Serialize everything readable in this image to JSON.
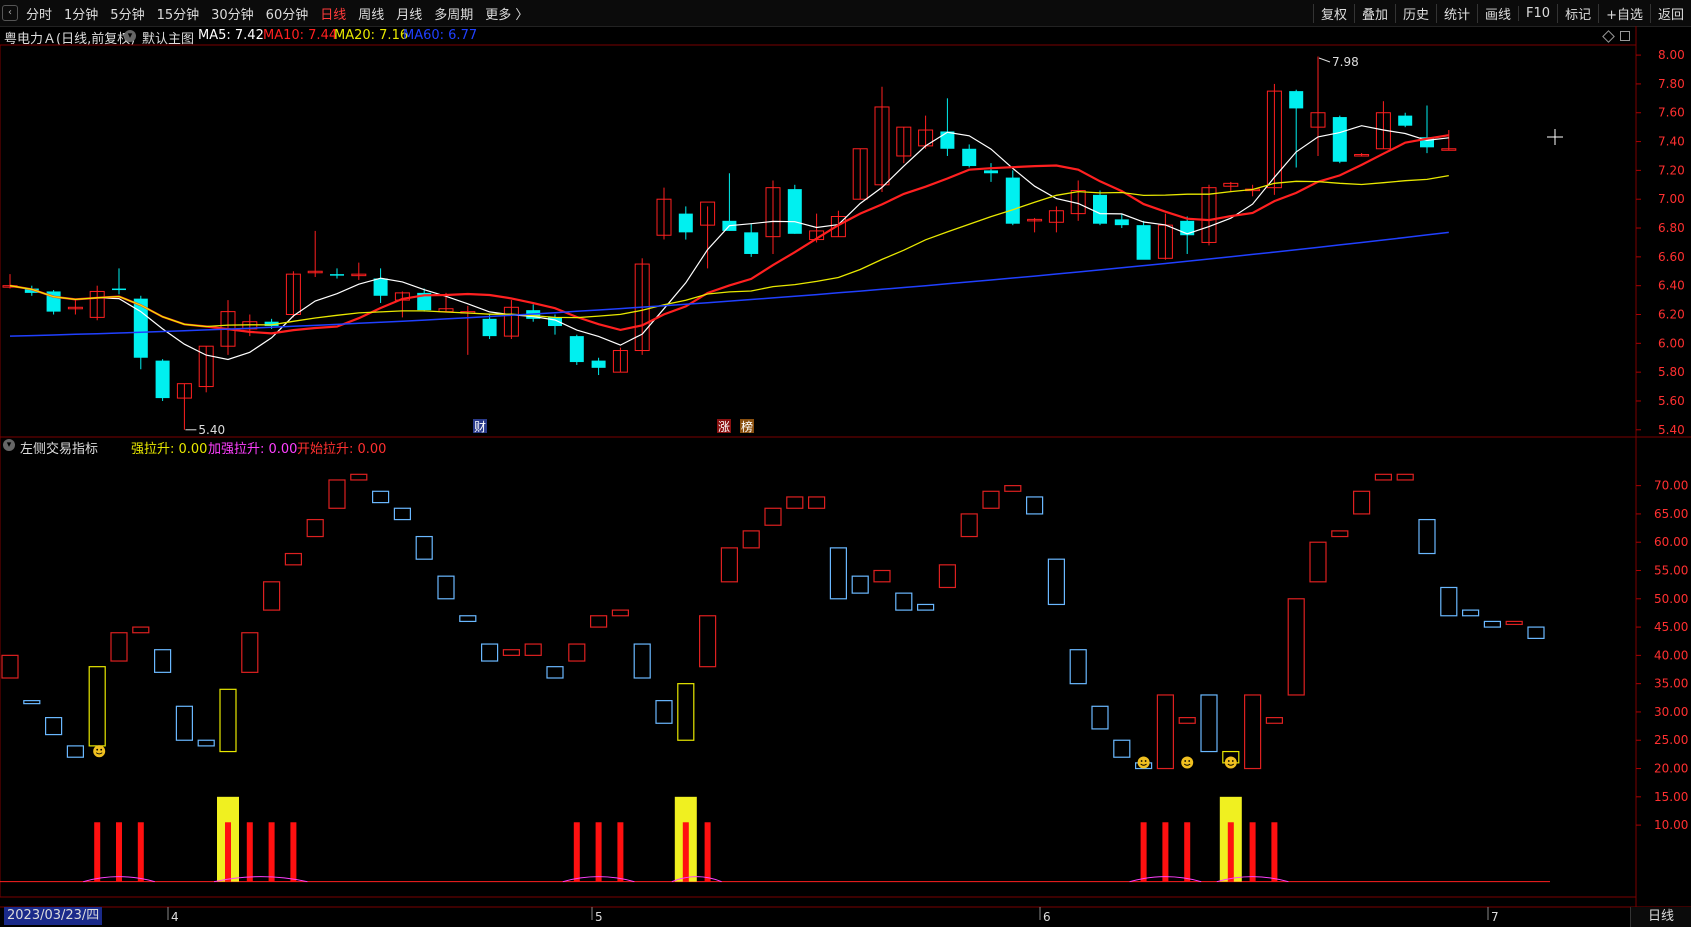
{
  "toolbar": {
    "periods": [
      {
        "label": "分时",
        "active": false
      },
      {
        "label": "1分钟",
        "active": false
      },
      {
        "label": "5分钟",
        "active": false
      },
      {
        "label": "15分钟",
        "active": false
      },
      {
        "label": "30分钟",
        "active": false
      },
      {
        "label": "60分钟",
        "active": false
      },
      {
        "label": "日线",
        "active": true
      },
      {
        "label": "周线",
        "active": false
      },
      {
        "label": "月线",
        "active": false
      },
      {
        "label": "多周期",
        "active": false
      },
      {
        "label": "更多 〉",
        "active": false
      }
    ],
    "tools": [
      "复权",
      "叠加",
      "历史",
      "统计",
      "画线",
      "F10",
      "标记",
      "+自选",
      "返回"
    ]
  },
  "main_chart": {
    "stock_title": "粤电力Ａ(日线,前复权)",
    "template": "默认主图",
    "ma": [
      {
        "label": "MA5: 7.42",
        "color": "#ffffff"
      },
      {
        "label": "MA10: 7.44",
        "color": "#ff2020"
      },
      {
        "label": "MA20: 7.16",
        "color": "#e8e800"
      },
      {
        "label": "MA60: 6.77",
        "color": "#2040ff"
      }
    ],
    "high_label": "7.98",
    "low_label": "5.40",
    "markers": [
      "财",
      "涨",
      "榜"
    ]
  },
  "indicator": {
    "name": "左侧交易指标",
    "values": [
      {
        "label": "强拉升: 0.00",
        "color": "#e8e800"
      },
      {
        "label": "加强拉升: 0.00",
        "color": "#ff40ff"
      },
      {
        "label": "开始拉升: 0.00",
        "color": "#ff3030"
      }
    ]
  },
  "axis": {
    "main_ticks": [
      "8.00",
      "7.80",
      "7.60",
      "7.40",
      "7.20",
      "7.00",
      "6.80",
      "6.60",
      "6.40",
      "6.20",
      "6.00",
      "5.80",
      "5.60",
      "5.40"
    ],
    "ind_ticks": [
      "70.00",
      "65.00",
      "60.00",
      "55.00",
      "50.00",
      "45.00",
      "40.00",
      "35.00",
      "30.00",
      "25.00",
      "20.00",
      "15.00",
      "10.00"
    ],
    "months": [
      "4",
      "5",
      "6",
      "7"
    ],
    "current_date": "2023/03/23/四"
  },
  "bottom_tab": "日线",
  "colors": {
    "up": "#ff2020",
    "down": "#00f0f0",
    "ma5": "#ffffff",
    "ma10": "#ff2020",
    "ma20": "#e8e800",
    "ma60": "#2040ff",
    "grid": "#5a0000"
  },
  "chart_data": {
    "type": "candlestick",
    "candles": [
      [
        6.4,
        6.48,
        6.38,
        6.4
      ],
      [
        6.38,
        6.4,
        6.33,
        6.35
      ],
      [
        6.36,
        6.37,
        6.2,
        6.22
      ],
      [
        6.24,
        6.3,
        6.2,
        6.25
      ],
      [
        6.18,
        6.4,
        6.16,
        6.36
      ],
      [
        6.38,
        6.52,
        6.34,
        6.37
      ],
      [
        6.31,
        6.33,
        5.82,
        5.9
      ],
      [
        5.88,
        5.89,
        5.6,
        5.62
      ],
      [
        5.62,
        5.72,
        5.4,
        5.72
      ],
      [
        5.7,
        5.98,
        5.66,
        5.98
      ],
      [
        5.98,
        6.3,
        5.92,
        6.22
      ],
      [
        6.1,
        6.2,
        6.05,
        6.15
      ],
      [
        6.15,
        6.17,
        6.1,
        6.12
      ],
      [
        6.2,
        6.5,
        6.18,
        6.48
      ],
      [
        6.5,
        6.78,
        6.46,
        6.5
      ],
      [
        6.48,
        6.52,
        6.45,
        6.47
      ],
      [
        6.48,
        6.56,
        6.44,
        6.48
      ],
      [
        6.45,
        6.52,
        6.28,
        6.33
      ],
      [
        6.3,
        6.36,
        6.18,
        6.35
      ],
      [
        6.35,
        6.38,
        6.22,
        6.23
      ],
      [
        6.22,
        6.35,
        6.22,
        6.24
      ],
      [
        6.22,
        6.26,
        5.92,
        6.22
      ],
      [
        6.17,
        6.2,
        6.03,
        6.05
      ],
      [
        6.05,
        6.3,
        6.03,
        6.25
      ],
      [
        6.23,
        6.27,
        6.15,
        6.17
      ],
      [
        6.18,
        6.2,
        6.06,
        6.12
      ],
      [
        6.05,
        6.06,
        5.85,
        5.87
      ],
      [
        5.88,
        5.9,
        5.78,
        5.83
      ],
      [
        5.8,
        5.97,
        5.8,
        5.95
      ],
      [
        5.95,
        6.59,
        5.92,
        6.55
      ],
      [
        6.75,
        7.08,
        6.72,
        7.0
      ],
      [
        6.9,
        6.95,
        6.72,
        6.77
      ],
      [
        6.82,
        6.95,
        6.52,
        6.98
      ],
      [
        6.85,
        7.18,
        6.78,
        6.78
      ],
      [
        6.77,
        6.83,
        6.6,
        6.62
      ],
      [
        6.74,
        7.13,
        6.62,
        7.08
      ],
      [
        7.07,
        7.1,
        6.76,
        6.76
      ],
      [
        6.72,
        6.9,
        6.7,
        6.78
      ],
      [
        6.74,
        6.92,
        6.74,
        6.88
      ],
      [
        7.0,
        7.35,
        7.0,
        7.35
      ],
      [
        7.1,
        7.78,
        7.05,
        7.64
      ],
      [
        7.3,
        7.5,
        7.25,
        7.5
      ],
      [
        7.37,
        7.58,
        7.35,
        7.48
      ],
      [
        7.47,
        7.7,
        7.3,
        7.35
      ],
      [
        7.35,
        7.38,
        7.22,
        7.23
      ],
      [
        7.2,
        7.25,
        7.12,
        7.18
      ],
      [
        7.15,
        7.2,
        6.82,
        6.83
      ],
      [
        6.85,
        6.87,
        6.77,
        6.86
      ],
      [
        6.84,
        6.95,
        6.77,
        6.92
      ],
      [
        6.9,
        7.13,
        6.85,
        7.06
      ],
      [
        7.03,
        7.06,
        6.82,
        6.83
      ],
      [
        6.86,
        6.9,
        6.8,
        6.82
      ],
      [
        6.82,
        6.85,
        6.6,
        6.58
      ],
      [
        6.59,
        6.9,
        6.58,
        6.82
      ],
      [
        6.85,
        6.88,
        6.62,
        6.75
      ],
      [
        6.7,
        7.1,
        6.68,
        7.08
      ],
      [
        7.09,
        7.12,
        7.05,
        7.11
      ],
      [
        7.06,
        7.1,
        7.02,
        7.07
      ],
      [
        7.08,
        7.8,
        7.03,
        7.75
      ],
      [
        7.75,
        7.76,
        7.22,
        7.63
      ],
      [
        7.5,
        7.99,
        7.3,
        7.6
      ],
      [
        7.57,
        7.58,
        7.25,
        7.26
      ],
      [
        7.3,
        7.32,
        7.3,
        7.31
      ],
      [
        7.35,
        7.68,
        7.35,
        7.6
      ],
      [
        7.58,
        7.6,
        7.5,
        7.51
      ],
      [
        7.43,
        7.65,
        7.32,
        7.36
      ],
      [
        7.34,
        7.48,
        7.34,
        7.35
      ]
    ],
    "ma60_start": 6.05,
    "ma60_end": 6.77,
    "indicator": {
      "boxes": [
        [
          36,
          40
        ],
        [
          33,
          32
        ],
        [
          26,
          29
        ],
        [
          22,
          24
        ],
        [
          24,
          38
        ],
        [
          39,
          44
        ],
        [
          44,
          45
        ],
        [
          37,
          41
        ],
        [
          25,
          31
        ],
        [
          24,
          25
        ],
        [
          23,
          34
        ],
        [
          37,
          44
        ],
        [
          48,
          53
        ],
        [
          56,
          58
        ],
        [
          61,
          64
        ],
        [
          66,
          71
        ],
        [
          71,
          72
        ],
        [
          67,
          69
        ],
        [
          64,
          66
        ],
        [
          57,
          61
        ],
        [
          50,
          54
        ],
        [
          46,
          47
        ],
        [
          39,
          42
        ],
        [
          40,
          41
        ],
        [
          40,
          42
        ],
        [
          36,
          38
        ],
        [
          39,
          42
        ],
        [
          45,
          47
        ],
        [
          47,
          48
        ],
        [
          36,
          42
        ],
        [
          28,
          32
        ],
        [
          25,
          35
        ],
        [
          38,
          47
        ],
        [
          53,
          59
        ],
        [
          59,
          62
        ],
        [
          63,
          66
        ],
        [
          66,
          68
        ],
        [
          66,
          68
        ],
        [
          50,
          59
        ],
        [
          51,
          54
        ],
        [
          53,
          55
        ],
        [
          48,
          51
        ],
        [
          48,
          49
        ],
        [
          52,
          56
        ],
        [
          61,
          65
        ],
        [
          66,
          69
        ],
        [
          69,
          70
        ],
        [
          65,
          68
        ],
        [
          49,
          57
        ],
        [
          35,
          41
        ],
        [
          27,
          31
        ],
        [
          22,
          25
        ],
        [
          20,
          21
        ],
        [
          20,
          33
        ],
        [
          28,
          29
        ],
        [
          23,
          33
        ],
        [
          21,
          23
        ],
        [
          20,
          33
        ],
        [
          28,
          29
        ],
        [
          33,
          50
        ],
        [
          53,
          60
        ],
        [
          61,
          62
        ],
        [
          65,
          69
        ],
        [
          71,
          72
        ],
        [
          71,
          72
        ],
        [
          58,
          64
        ],
        [
          47,
          52
        ],
        [
          47,
          48
        ],
        [
          45,
          46
        ],
        [
          46,
          46
        ],
        [
          43,
          45
        ]
      ],
      "bar_days": [
        4,
        5,
        6,
        10,
        11,
        12,
        13,
        26,
        27,
        28,
        31,
        32,
        52,
        53,
        54,
        56,
        57,
        58
      ],
      "yellow_days": [
        10,
        31,
        56
      ]
    }
  }
}
